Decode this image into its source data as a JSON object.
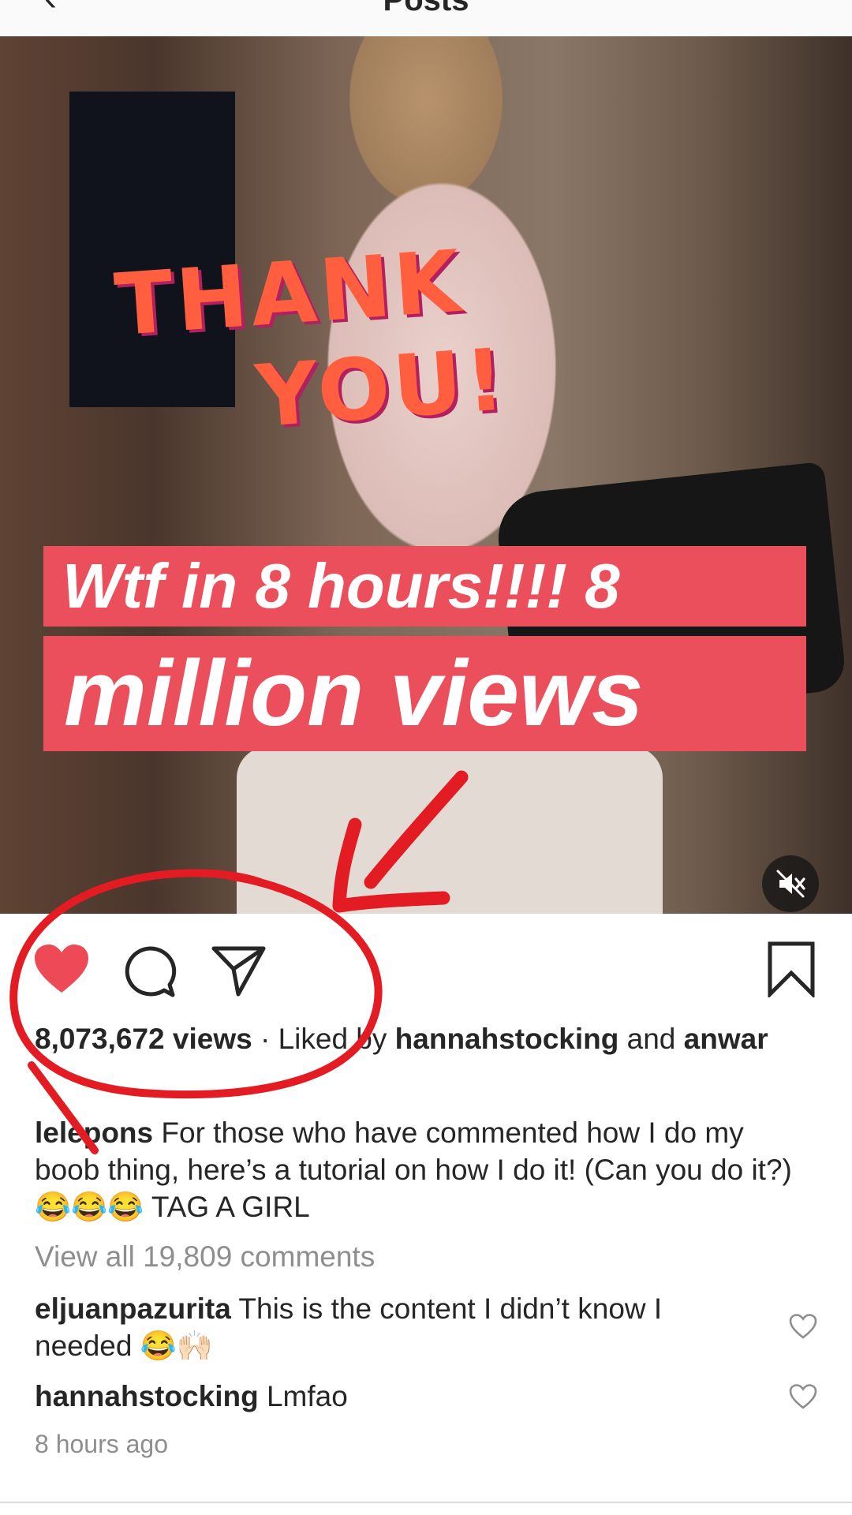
{
  "topbar": {
    "title": "Posts",
    "back_icon": "chevron-left-icon"
  },
  "media": {
    "sticker_line1": "THANK",
    "sticker_line2": "YOU!",
    "caption_line1": "Wtf in 8 hours!!!! 8",
    "caption_line2": "million views",
    "mute_icon": "speaker-muted-icon"
  },
  "actions": {
    "like_icon": "heart-filled-icon",
    "comment_icon": "comment-bubble-icon",
    "share_icon": "paper-plane-icon",
    "save_icon": "bookmark-icon",
    "like_color": "#ed4956"
  },
  "stats": {
    "views": "8,073,672 views",
    "separator": "·",
    "liked_by_prefix": "Liked by",
    "liked_by_user": "hannahstocking",
    "and": "and",
    "others": "anwar"
  },
  "caption": {
    "username": "lelepons",
    "text": "For those who have commented how I do my boob thing, here’s a tutorial on how I do it! (Can you do it?) 😂😂😂 TAG A GIRL"
  },
  "comments": {
    "view_all": "View all 19,809 comments",
    "items": [
      {
        "username": "eljuanpazurita",
        "text": "This is the content I didn’t know I needed 😂🙌🏻"
      },
      {
        "username": "hannahstocking",
        "text": "Lmfao"
      }
    ]
  },
  "timestamp": "8 hours ago",
  "colors": {
    "annotation_red": "#e31b23",
    "caption_bg": "#ec4f5c",
    "sticker": "#ff5f3e"
  }
}
